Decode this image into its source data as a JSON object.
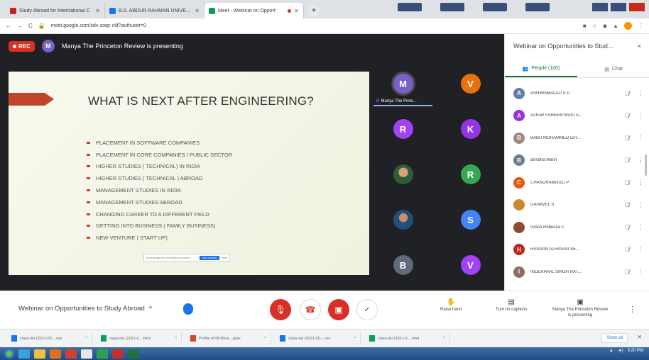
{
  "browser": {
    "tabs": [
      {
        "title": "Study Abroad for International C",
        "active": false,
        "favicon_color": "#c5221f"
      },
      {
        "title": "B.S. ABDUR RAHMAN UNIVERSI",
        "active": false,
        "favicon_color": "#1a73e8"
      },
      {
        "title": "Meet - Webinar on Opport",
        "active": true,
        "favicon_color": "#0f9d58"
      }
    ],
    "new_tab_label": "+",
    "url": "meet.google.com/sdv-zoqc-ckf?authuser=0"
  },
  "meet": {
    "rec_label": "REC",
    "presenter_initial": "M",
    "presenting_text": "Manya The Princeton Review is presenting",
    "slide": {
      "title": "WHAT IS NEXT AFTER ENGINEERING?",
      "bullets": [
        "PLACEMENT IN SOFTWARE COMPANIES",
        "PLACEMENT IN CORE COMPANIES / PUBLIC SECTOR",
        "HIGHER STUDIES ( TECHNICAL) IN INDIA",
        "HIGHER STUDIES ( TECHNICAL ) ABROAD",
        "MANAGEMENT STUDIES IN INDIA",
        "MANAGEMENT STUDIES ABROAD",
        "CHANGING CAREER TO A DIFFERENT FIELD",
        "GETTING INTO BUSINESS ( FAMILY BUSINESS)",
        "NEW VENTURE ( START UP)"
      ],
      "share_text": "meet.google.com is sharing your screen.",
      "share_button": "Stop sharing",
      "share_hide": "Hide"
    },
    "tiles": [
      {
        "initial": "M",
        "color": "#7b5fc9",
        "label": "Manya The Princ...",
        "speaking": true
      },
      {
        "initial": "V",
        "color": "#e8710a"
      },
      {
        "initial": "R",
        "color": "#a142f4"
      },
      {
        "initial": "K",
        "color": "#9334e6"
      },
      {
        "initial": "",
        "photo": true
      },
      {
        "initial": "R",
        "color": "#34a853"
      },
      {
        "initial": "",
        "photo": true
      },
      {
        "initial": "S",
        "color": "#4285f4"
      },
      {
        "initial": "B",
        "color": "#5f6b7a"
      },
      {
        "initial": "V",
        "color": "#a142f4"
      }
    ],
    "panel": {
      "title": "Webinar on Opportunities to Stud...",
      "close": "×",
      "people_tab": "People (100)",
      "chat_tab": "Chat",
      "people": [
        {
          "initial": "A",
          "color": "#5f7ea8",
          "name": "ASHWINBALAJI S P"
        },
        {
          "initial": "A",
          "color": "#9334e6",
          "name": "AZFAR FAHEEM MUSTA..."
        },
        {
          "initial": "B",
          "color": "#a1887f",
          "name": "BABU MOHAMMED IZH..."
        },
        {
          "initial": "B",
          "color": "#6f7d91",
          "name": "Brindha Marin"
        },
        {
          "initial": "C",
          "color": "#e8590c",
          "name": "CHANDRAMOULI P"
        },
        {
          "initial": "",
          "color": "#c98b2b",
          "name": "GANAVEL S"
        },
        {
          "initial": "",
          "color": "#8d4b32",
          "name": "Grace Rebecca C"
        },
        {
          "initial": "H",
          "color": "#c5221f",
          "name": "HANAAN ALHASAN SE..."
        },
        {
          "initial": "I",
          "color": "#8d6e63",
          "name": "INDERPAAL SINGH RAT..."
        }
      ]
    },
    "controls": {
      "meeting_title": "Webinar on Opportunities to Study Abroad",
      "raise_hand": "Raise hand",
      "captions": "Turn on captions",
      "presenting_line1": "Manya The Princeton Review",
      "presenting_line2": "is presenting"
    }
  },
  "downloads": {
    "items": [
      {
        "name": "class-list (2021-05-...csv",
        "color": "#1a73e8"
      },
      {
        "name": "class-list (2021-0....html",
        "color": "#0f9d58"
      },
      {
        "name": "Profile of Mr.Bhar....pptx",
        "color": "#d24726"
      },
      {
        "name": "class-list (2021-05-...csv",
        "color": "#1a73e8"
      },
      {
        "name": "class-list (2021-0....html",
        "color": "#0f9d58"
      }
    ],
    "show_all": "Show all"
  },
  "taskbar": {
    "time": "3:20 PM"
  }
}
